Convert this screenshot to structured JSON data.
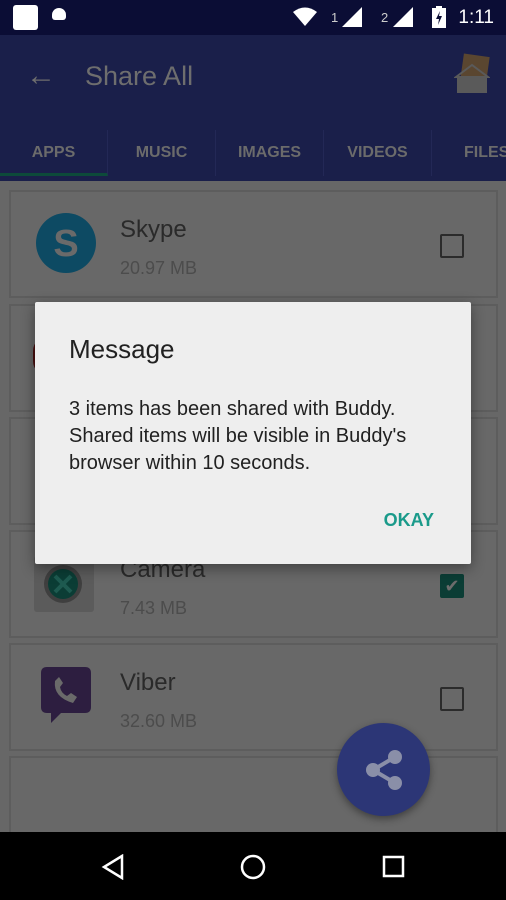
{
  "status_bar": {
    "time": "1:11",
    "sim1": "1",
    "sim2": "2"
  },
  "toolbar": {
    "title": "Share All"
  },
  "tabs": [
    {
      "label": "APPS",
      "active": true
    },
    {
      "label": "MUSIC"
    },
    {
      "label": "IMAGES"
    },
    {
      "label": "VIDEOS"
    },
    {
      "label": "FILES"
    }
  ],
  "apps": [
    {
      "name": "Skype",
      "size": "20.97 MB",
      "checked": false
    },
    {
      "name": "Camera",
      "size": "7.43 MB",
      "checked": true
    },
    {
      "name": "Viber",
      "size": "32.60 MB",
      "checked": false
    }
  ],
  "dialog": {
    "title": "Message",
    "message": "3 items has been shared with Buddy. Shared items will be visible in Buddy's browser within 10 seconds.",
    "ok_label": "OKAY"
  },
  "colors": {
    "toolbar": "#1a1f4a",
    "accent": "#1a9a8a",
    "fab": "#2c3676"
  }
}
